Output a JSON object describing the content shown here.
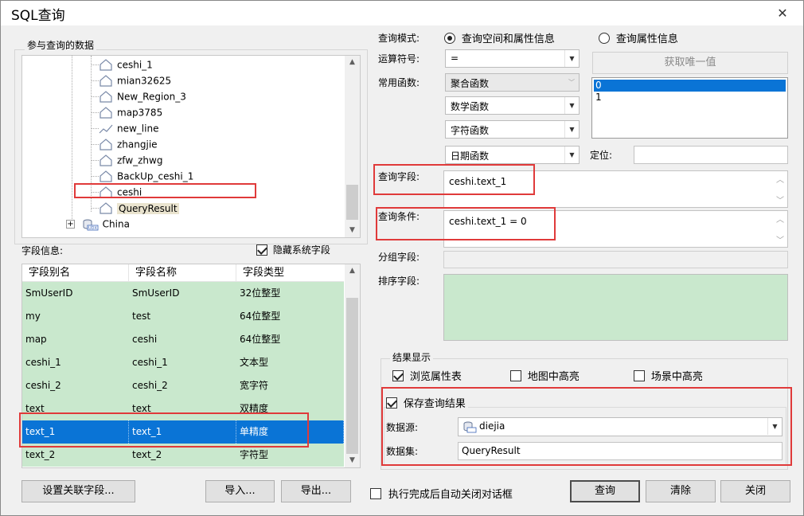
{
  "window": {
    "title": "SQL查询",
    "close_glyph": "✕"
  },
  "tree_group": {
    "label": "参与查询的数据",
    "items": [
      {
        "label": "ceshi_1",
        "icon": "region-dataset-icon"
      },
      {
        "label": "mian32625",
        "icon": "region-dataset-icon"
      },
      {
        "label": "New_Region_3",
        "icon": "region-dataset-icon"
      },
      {
        "label": "map3785",
        "icon": "region-dataset-icon"
      },
      {
        "label": "new_line",
        "icon": "line-dataset-icon"
      },
      {
        "label": "zhangjie",
        "icon": "region-dataset-icon"
      },
      {
        "label": "zfw_zhwg",
        "icon": "region-dataset-icon"
      },
      {
        "label": "BackUp_ceshi_1",
        "icon": "region-dataset-icon"
      },
      {
        "label": "ceshi",
        "icon": "region-dataset-icon"
      },
      {
        "label": "QueryResult",
        "icon": "region-dataset-icon"
      }
    ],
    "datasource": {
      "label": "China",
      "expand_glyph": "+",
      "icon": "udbx-datasource-icon"
    }
  },
  "field_info": {
    "label": "字段信息:",
    "hide_system_fields": {
      "label": "隐藏系统字段",
      "checked": true
    },
    "columns": [
      "字段别名",
      "字段名称",
      "字段类型"
    ],
    "rows": [
      [
        "SmUserID",
        "SmUserID",
        "32位整型"
      ],
      [
        "my",
        "test",
        "64位整型"
      ],
      [
        "map",
        "ceshi",
        "64位整型"
      ],
      [
        "ceshi_1",
        "ceshi_1",
        "文本型"
      ],
      [
        "ceshi_2",
        "ceshi_2",
        "宽字符"
      ],
      [
        "text",
        "text",
        "双精度"
      ],
      [
        "text_1",
        "text_1",
        "单精度"
      ],
      [
        "text_2",
        "text_2",
        "字符型"
      ]
    ],
    "selected_row_index": 6
  },
  "query_mode": {
    "label": "查询模式:",
    "option_spatial": "查询空间和属性信息",
    "option_attr": "查询属性信息",
    "selected": "spatial"
  },
  "operator": {
    "label": "运算符号:",
    "value": "="
  },
  "functions": {
    "label": "常用函数:",
    "aggregate": "聚合函数",
    "math": "数学函数",
    "string": "字符函数",
    "date": "日期函数"
  },
  "unique_values": {
    "button": "获取唯一值",
    "items": [
      "0",
      "1"
    ],
    "selected_index": 0
  },
  "locate": {
    "label": "定位:",
    "value": ""
  },
  "query_field": {
    "label": "查询字段:",
    "value": "ceshi.text_1"
  },
  "query_condition": {
    "label": "查询条件:",
    "value": "ceshi.text_1 = 0"
  },
  "group_field": {
    "label": "分组字段:",
    "value": ""
  },
  "sort_field": {
    "label": "排序字段:"
  },
  "result_display": {
    "label": "结果显示",
    "browse_attr": {
      "label": "浏览属性表",
      "checked": true
    },
    "map_highlight": {
      "label": "地图中高亮",
      "checked": false
    },
    "scene_highlight": {
      "label": "场景中高亮",
      "checked": false
    }
  },
  "save_result": {
    "label": "保存查询结果",
    "checked": true,
    "datasource_label": "数据源:",
    "datasource_value": "diejia",
    "dataset_label": "数据集:",
    "dataset_value": "QueryResult"
  },
  "buttons": {
    "relate_fields": "设置关联字段...",
    "import": "导入...",
    "export": "导出...",
    "auto_close": "执行完成后自动关闭对话框",
    "query": "查询",
    "clear": "清除",
    "close": "关闭"
  },
  "colors": {
    "selection_blue": "#0a74d6",
    "field_row_green": "#c9e8cd",
    "sort_area_green": "#c9e8cd",
    "highlight_red": "#e03a3a"
  }
}
